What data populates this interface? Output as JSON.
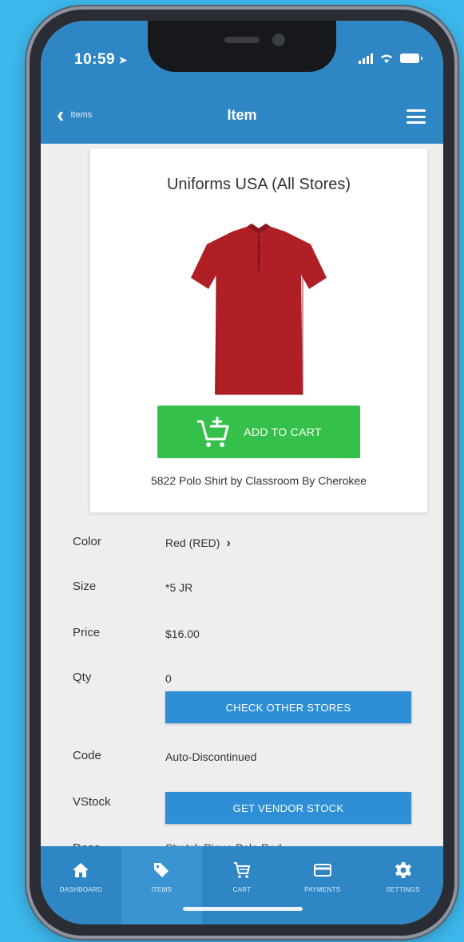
{
  "status_bar": {
    "time": "10:59",
    "location_arrow": "➤"
  },
  "navbar": {
    "back_label": "Items",
    "title": "Item"
  },
  "product": {
    "store": "Uniforms USA (All Stores)",
    "add_to_cart_label": "ADD TO CART",
    "description": "5822 Polo Shirt by Classroom By Cherokee",
    "image_color": "#b01f25"
  },
  "details": {
    "color_label": "Color",
    "color_value": "Red (RED)",
    "size_label": "Size",
    "size_value": "*5 JR",
    "price_label": "Price",
    "price_value": "$16.00",
    "qty_label": "Qty",
    "qty_value": "0",
    "check_other_stores_label": "CHECK OTHER STORES",
    "code_label": "Code",
    "code_value": "Auto-Discontinued",
    "vstock_label": "VStock",
    "get_vendor_stock_label": "GET VENDOR STOCK",
    "desc_label": "Desc",
    "desc_value": "Stretch Pique Polo Red"
  },
  "tabs": [
    {
      "label": "DASHBOARD",
      "icon": "home-icon",
      "active": false
    },
    {
      "label": "ITEMS",
      "icon": "tag-icon",
      "active": true
    },
    {
      "label": "CART",
      "icon": "cart-icon",
      "active": false
    },
    {
      "label": "PAYMENTS",
      "icon": "card-icon",
      "active": false
    },
    {
      "label": "SETTINGS",
      "icon": "gear-icon",
      "active": false
    }
  ],
  "colors": {
    "primary_blue": "#2f86c4",
    "button_blue": "#2f8fd6",
    "add_to_cart_green": "#35c04b",
    "background": "#3cb8ec"
  }
}
